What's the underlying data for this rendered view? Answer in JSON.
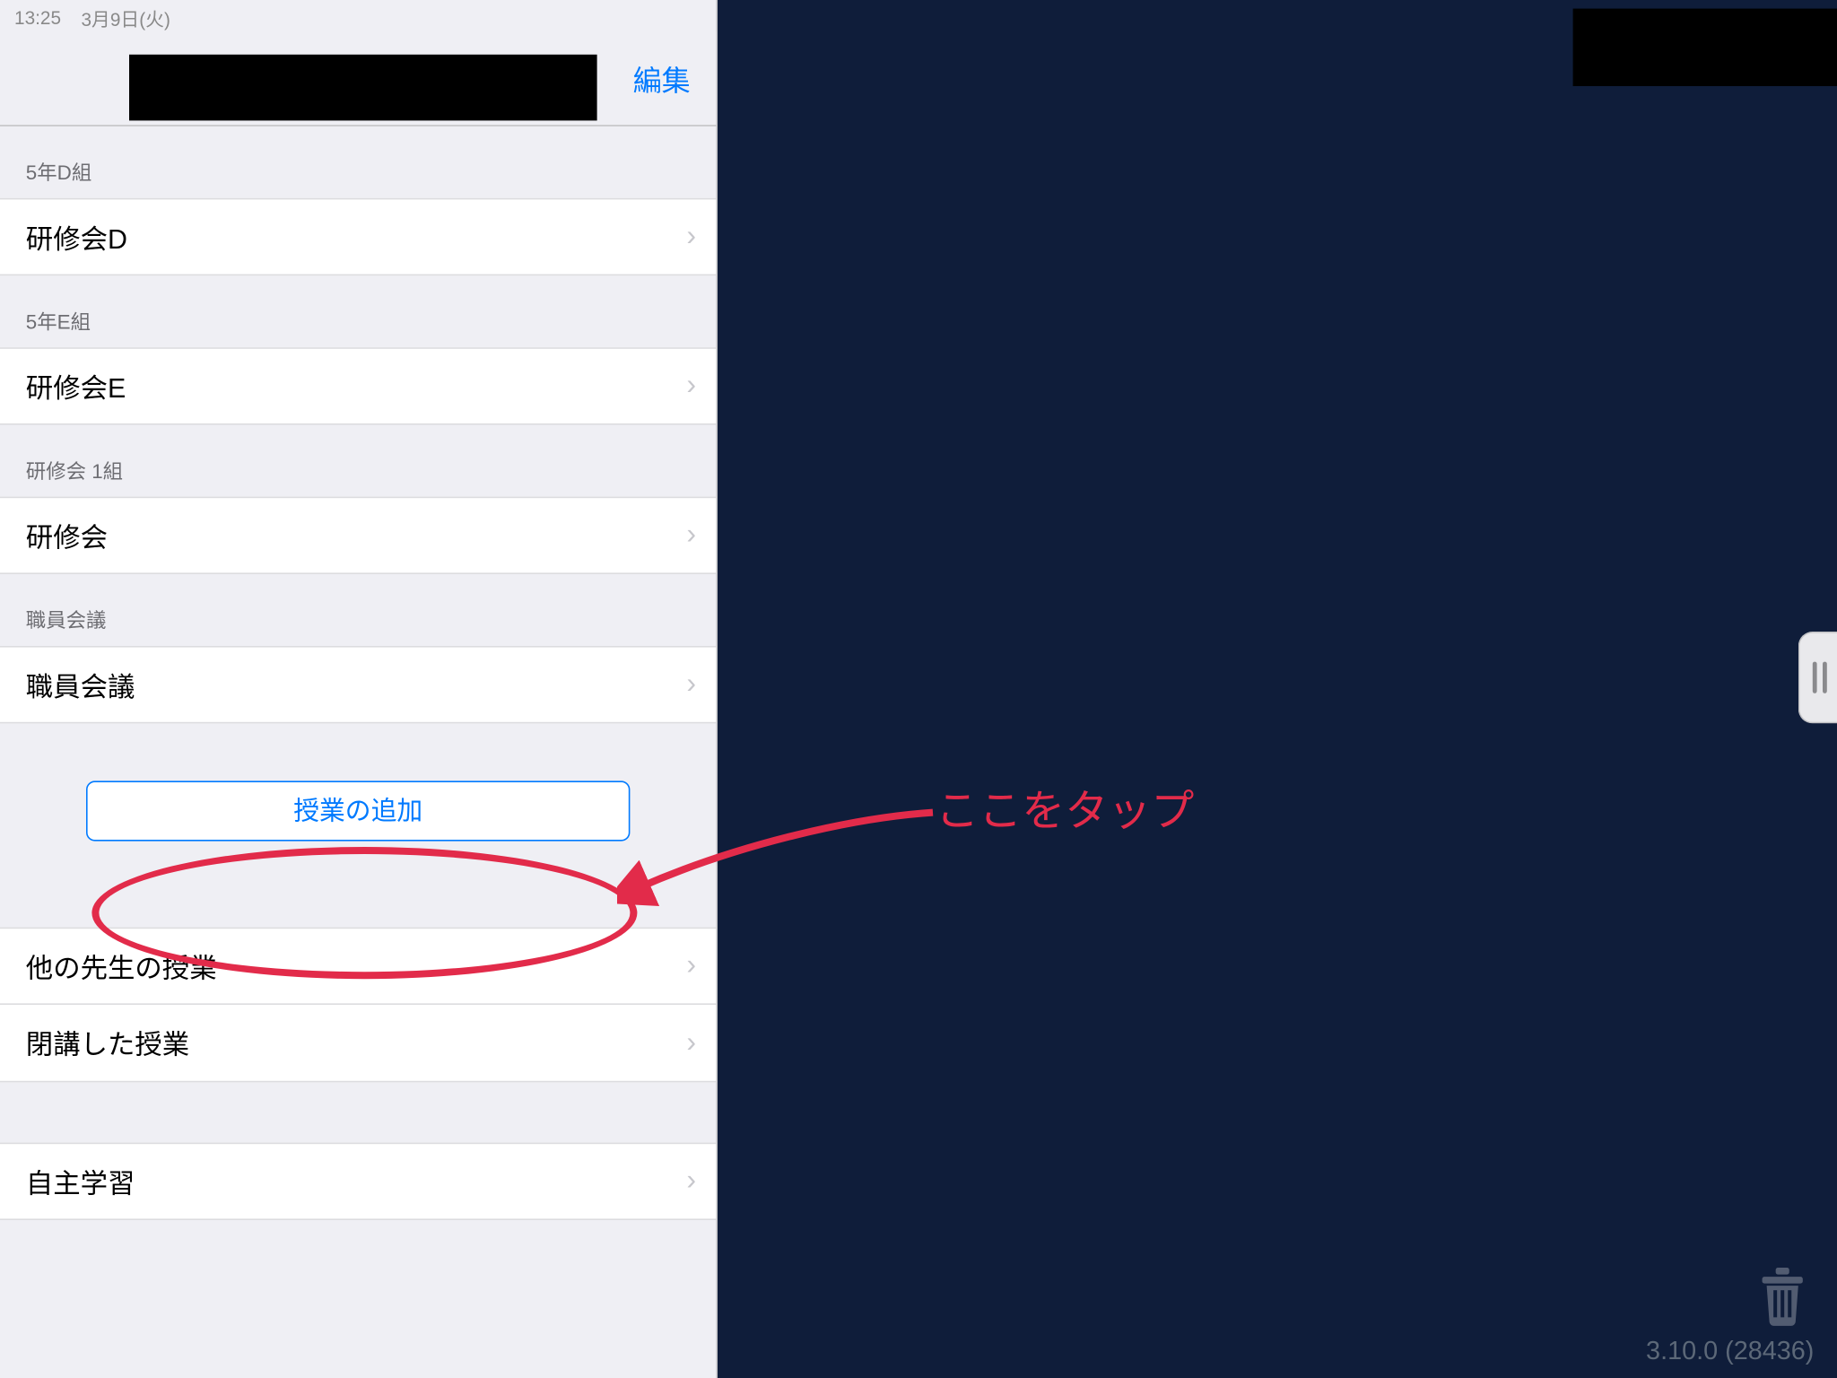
{
  "status": {
    "time": "13:25",
    "date": "3月9日(火)"
  },
  "nav": {
    "edit": "編集"
  },
  "sections": [
    {
      "header": "5年D組",
      "rows": [
        "研修会D"
      ]
    },
    {
      "header": "5年E組",
      "rows": [
        "研修会E"
      ]
    },
    {
      "header": "研修会 1組",
      "rows": [
        "研修会"
      ]
    },
    {
      "header": "職員会議",
      "rows": [
        "職員会議"
      ]
    }
  ],
  "add_button": "授業の追加",
  "lower_rows": {
    "r0": "他の先生の授業",
    "r1": "閉講した授業",
    "r2": "自主学習"
  },
  "right": {
    "version": "3.10.0 (28436)"
  },
  "annotation": {
    "text": "ここをタップ"
  },
  "colors": {
    "ios_blue": "#007aff",
    "annot_red": "#e22b4a",
    "bg_navy": "#0f1d3a"
  }
}
